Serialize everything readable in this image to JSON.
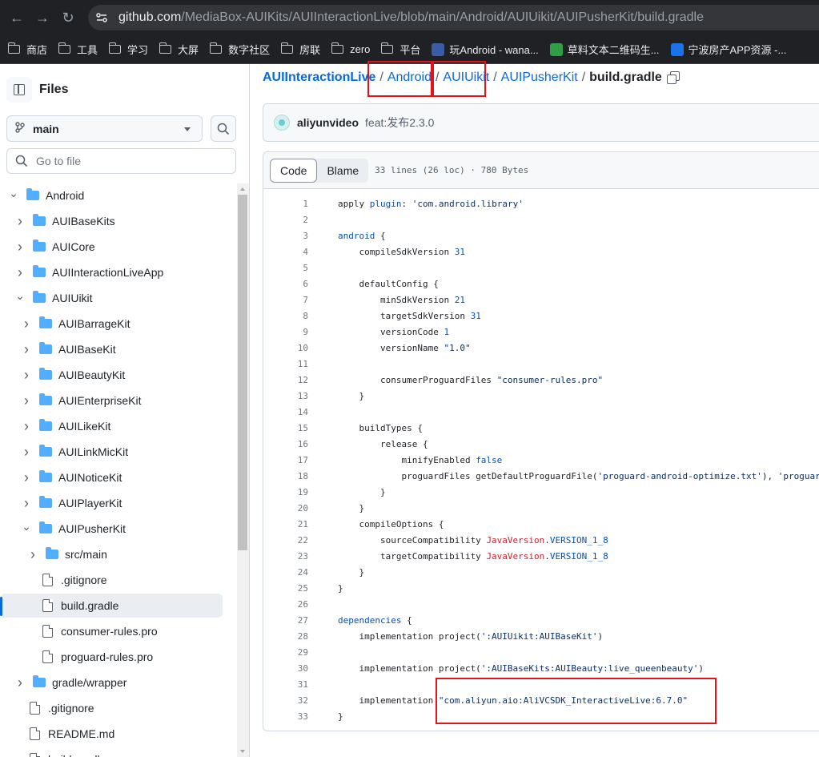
{
  "browser": {
    "url_host": "github.com",
    "url_path": "/MediaBox-AUIKits/AUIInteractionLive/blob/main/Android/AUIUikit/AUIPusherKit/build.gradle"
  },
  "bookmarks": [
    {
      "label": "商店",
      "icon": "folder-icon"
    },
    {
      "label": "工具",
      "icon": "folder-icon"
    },
    {
      "label": "学习",
      "icon": "folder-icon"
    },
    {
      "label": "大屏",
      "icon": "folder-icon"
    },
    {
      "label": "数字社区",
      "icon": "folder-icon"
    },
    {
      "label": "房联",
      "icon": "folder-icon"
    },
    {
      "label": "zero",
      "icon": "folder-icon"
    },
    {
      "label": "平台",
      "icon": "folder-icon"
    },
    {
      "label": "玩Android - wana...",
      "icon": "android-icon",
      "color": "#3b5ba5"
    },
    {
      "label": "草料文本二维码生...",
      "icon": "qrcode-icon",
      "color": "#2f9e44"
    },
    {
      "label": "宁波房产APP资源 -...",
      "icon": "cloud-icon",
      "color": "#1a73e8"
    }
  ],
  "sidebar": {
    "title": "Files",
    "branch": "main",
    "goto_placeholder": "Go to file",
    "tree": [
      {
        "label": "Android",
        "type": "folder",
        "depth": 0,
        "expanded": true
      },
      {
        "label": "AUIBaseKits",
        "type": "folder",
        "depth": 1,
        "expanded": false
      },
      {
        "label": "AUICore",
        "type": "folder",
        "depth": 1,
        "expanded": false
      },
      {
        "label": "AUIInteractionLiveApp",
        "type": "folder",
        "depth": 1,
        "expanded": false
      },
      {
        "label": "AUIUikit",
        "type": "folder",
        "depth": 1,
        "expanded": true
      },
      {
        "label": "AUIBarrageKit",
        "type": "folder",
        "depth": 2,
        "expanded": false
      },
      {
        "label": "AUIBaseKit",
        "type": "folder",
        "depth": 2,
        "expanded": false
      },
      {
        "label": "AUIBeautyKit",
        "type": "folder",
        "depth": 2,
        "expanded": false
      },
      {
        "label": "AUIEnterpriseKit",
        "type": "folder",
        "depth": 2,
        "expanded": false
      },
      {
        "label": "AUILikeKit",
        "type": "folder",
        "depth": 2,
        "expanded": false
      },
      {
        "label": "AUILinkMicKit",
        "type": "folder",
        "depth": 2,
        "expanded": false
      },
      {
        "label": "AUINoticeKit",
        "type": "folder",
        "depth": 2,
        "expanded": false
      },
      {
        "label": "AUIPlayerKit",
        "type": "folder",
        "depth": 2,
        "expanded": false
      },
      {
        "label": "AUIPusherKit",
        "type": "folder",
        "depth": 2,
        "expanded": true
      },
      {
        "label": "src/main",
        "type": "folder",
        "depth": 3,
        "expanded": false
      },
      {
        "label": ".gitignore",
        "type": "file",
        "depth": 3
      },
      {
        "label": "build.gradle",
        "type": "file",
        "depth": 3,
        "active": true
      },
      {
        "label": "consumer-rules.pro",
        "type": "file",
        "depth": 3
      },
      {
        "label": "proguard-rules.pro",
        "type": "file",
        "depth": 3
      },
      {
        "label": "gradle/wrapper",
        "type": "folder",
        "depth": 1,
        "expanded": false
      },
      {
        "label": ".gitignore",
        "type": "file",
        "depth": 1
      },
      {
        "label": "README.md",
        "type": "file",
        "depth": 1
      },
      {
        "label": "build.gradle",
        "type": "file",
        "depth": 1
      }
    ]
  },
  "breadcrumb": {
    "repo": "AUIInteractionLive",
    "parts": [
      "Android",
      "AUIUikit",
      "AUIPusherKit"
    ],
    "current": "build.gradle"
  },
  "commit": {
    "author": "aliyunvideo",
    "message": "feat:发布2.3.0"
  },
  "code_view": {
    "tab_code": "Code",
    "tab_blame": "Blame",
    "info": "33 lines (26 loc) · 780 Bytes",
    "lines": [
      [
        {
          "t": "apply "
        },
        {
          "t": "plugin",
          "c": "kw"
        },
        {
          "t": ": "
        },
        {
          "t": "'com.android.library'",
          "c": "str"
        }
      ],
      [],
      [
        {
          "t": "android",
          "c": "kw"
        },
        {
          "t": " {"
        }
      ],
      [
        {
          "t": "    compileSdkVersion "
        },
        {
          "t": "31",
          "c": "kw"
        }
      ],
      [],
      [
        {
          "t": "    defaultConfig {"
        }
      ],
      [
        {
          "t": "        minSdkVersion "
        },
        {
          "t": "21",
          "c": "kw"
        }
      ],
      [
        {
          "t": "        targetSdkVersion "
        },
        {
          "t": "31",
          "c": "kw"
        }
      ],
      [
        {
          "t": "        versionCode "
        },
        {
          "t": "1",
          "c": "kw"
        }
      ],
      [
        {
          "t": "        versionName "
        },
        {
          "t": "\"1.0\"",
          "c": "str"
        }
      ],
      [],
      [
        {
          "t": "        consumerProguardFiles "
        },
        {
          "t": "\"consumer-rules.pro\"",
          "c": "str"
        }
      ],
      [
        {
          "t": "    }"
        }
      ],
      [],
      [
        {
          "t": "    buildTypes {"
        }
      ],
      [
        {
          "t": "        release {"
        }
      ],
      [
        {
          "t": "            minifyEnabled "
        },
        {
          "t": "false",
          "c": "kw"
        }
      ],
      [
        {
          "t": "            proguardFiles getDefaultProguardFile("
        },
        {
          "t": "'proguard-android-optimize.txt'",
          "c": "str"
        },
        {
          "t": "), "
        },
        {
          "t": "'proguard-rules.pro'",
          "c": "str"
        }
      ],
      [
        {
          "t": "        }"
        }
      ],
      [
        {
          "t": "    }"
        }
      ],
      [
        {
          "t": "    compileOptions {"
        }
      ],
      [
        {
          "t": "        sourceCompatibility "
        },
        {
          "t": "JavaVersion",
          "c": "red"
        },
        {
          "t": "."
        },
        {
          "t": "VERSION_1_8",
          "c": "kw"
        }
      ],
      [
        {
          "t": "        targetCompatibility "
        },
        {
          "t": "JavaVersion",
          "c": "red"
        },
        {
          "t": "."
        },
        {
          "t": "VERSION_1_8",
          "c": "kw"
        }
      ],
      [
        {
          "t": "    }"
        }
      ],
      [
        {
          "t": "}"
        }
      ],
      [],
      [
        {
          "t": "dependencies",
          "c": "kw"
        },
        {
          "t": " {"
        }
      ],
      [
        {
          "t": "    implementation project("
        },
        {
          "t": "':AUIUikit:AUIBaseKit'",
          "c": "str"
        },
        {
          "t": ")"
        }
      ],
      [],
      [
        {
          "t": "    implementation project("
        },
        {
          "t": "':AUIBaseKits:AUIBeauty:live_queenbeauty'",
          "c": "str"
        },
        {
          "t": ")"
        }
      ],
      [],
      [
        {
          "t": "    implementation "
        },
        {
          "t": "\"com.aliyun.aio:AliVCSDK_InteractiveLive:6.7.0\"",
          "c": "str"
        }
      ],
      [
        {
          "t": "}"
        }
      ]
    ]
  },
  "annotation_color": "#e3121b"
}
